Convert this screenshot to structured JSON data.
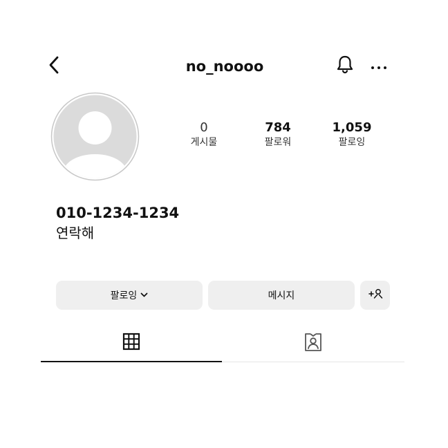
{
  "header": {
    "username": "no_noooo",
    "back_icon": "chevron-left-icon",
    "notification_icon": "bell-icon",
    "more_icon": "more-horizontal-icon"
  },
  "profile": {
    "avatar_icon": "default-avatar-icon",
    "stats": [
      {
        "value": "0",
        "label": "게시물"
      },
      {
        "value": "784",
        "label": "팔로워"
      },
      {
        "value": "1,059",
        "label": "팔로잉"
      }
    ],
    "bio_name": "010-1234-1234",
    "bio_text": "연락해"
  },
  "actions": {
    "following_label": "팔로잉",
    "following_chevron_icon": "chevron-down-icon",
    "message_label": "메시지",
    "add_user_label": "+옷",
    "add_user_icon": "add-person-icon"
  },
  "tabs": [
    {
      "icon": "grid-icon",
      "active": true
    },
    {
      "icon": "tagged-person-icon",
      "active": false
    }
  ],
  "colors": {
    "background": "#ffffff",
    "button_bg": "#efefef",
    "text": "#111111",
    "avatar_bg": "#dbdbdb",
    "avatar_ring": "#c7c7c7"
  }
}
